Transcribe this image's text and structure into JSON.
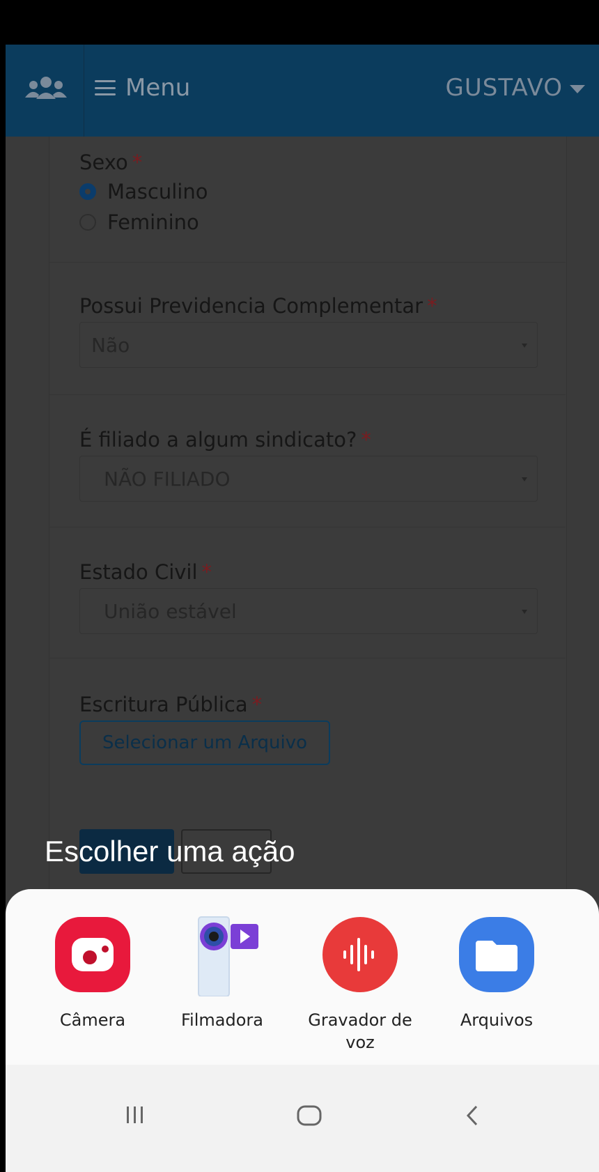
{
  "header": {
    "group_icon": "users-icon",
    "menu_label": "Menu",
    "user_name": "GUSTAVO"
  },
  "form": {
    "sexo": {
      "label": "Sexo",
      "required": "*",
      "options": [
        "Masculino",
        "Feminino"
      ],
      "selected": "Masculino"
    },
    "previdencia": {
      "label": "Possui Previdencia Complementar",
      "required": "*",
      "value": "Não"
    },
    "sindicato": {
      "label": "É filiado a algum sindicato?",
      "required": "*",
      "value": "NÃO FILIADO"
    },
    "estado_civil": {
      "label": "Estado Civil",
      "required": "*",
      "value": "União estável"
    },
    "escritura": {
      "label": "Escritura Pública",
      "required": "*",
      "button": "Selecionar um Arquivo"
    }
  },
  "chooser": {
    "title": "Escolher uma ação",
    "apps": [
      {
        "label": "Câmera",
        "icon": "camera-icon",
        "color": "#e8193c"
      },
      {
        "label": "Filmadora",
        "icon": "video-camera-icon",
        "color": "#7b3fd6"
      },
      {
        "label": "Gravador de voz",
        "icon": "voice-recorder-icon",
        "color": "#e83a3a"
      },
      {
        "label": "Arquivos",
        "icon": "folder-icon",
        "color": "#3b7de6"
      }
    ]
  },
  "navbar": {
    "recent": "recent-apps-icon",
    "home": "home-icon",
    "back": "back-icon"
  },
  "colors": {
    "header_bg": "#0b3c5d",
    "overlay": "#3b3b3b",
    "sheet_bg": "#fafafa"
  }
}
